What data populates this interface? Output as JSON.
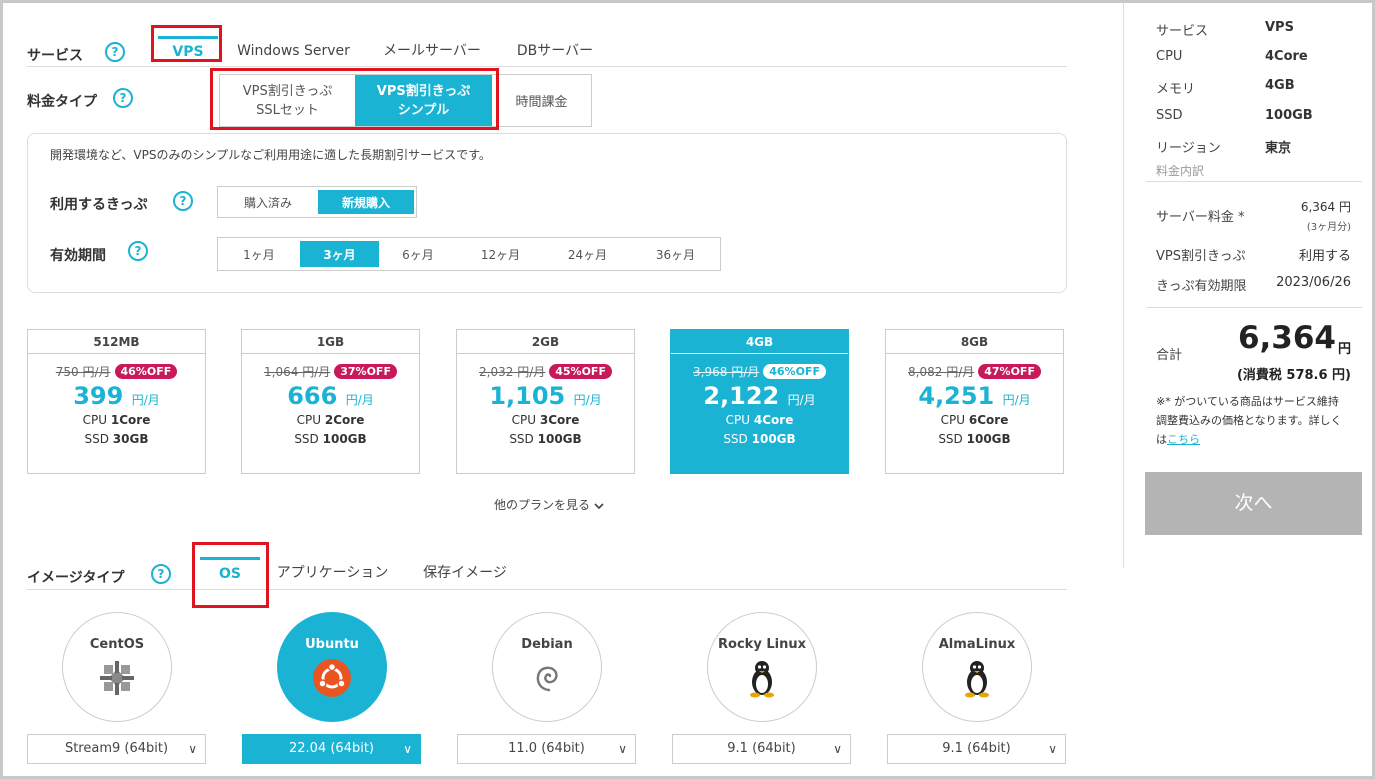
{
  "service": {
    "label": "サービス",
    "tabs": [
      "VPS",
      "Windows Server",
      "メールサーバー",
      "DBサーバー"
    ]
  },
  "plan_type": {
    "label": "料金タイプ",
    "options": [
      {
        "line1": "VPS割引きっぷ",
        "line2": "SSLセット"
      },
      {
        "line1": "VPS割引きっぷ",
        "line2": "シンプル"
      },
      {
        "line1": "時間課金",
        "line2": ""
      }
    ]
  },
  "description": "開発環境など、VPSのみのシンプルなご利用用途に適した長期割引サービスです。",
  "ticket": {
    "label": "利用するきっぷ",
    "options": [
      "購入済み",
      "新規購入"
    ]
  },
  "period": {
    "label": "有効期間",
    "options": [
      "1ヶ月",
      "3ヶ月",
      "6ヶ月",
      "12ヶ月",
      "24ヶ月",
      "36ヶ月"
    ]
  },
  "plans": [
    {
      "name": "512MB",
      "old": "750 円/月",
      "off": "46%OFF",
      "price": "399",
      "unit": "円/月",
      "cpu_label": "CPU",
      "cpu": "1Core",
      "ssd_label": "SSD",
      "ssd": "30GB"
    },
    {
      "name": "1GB",
      "old": "1,064 円/月",
      "off": "37%OFF",
      "price": "666",
      "unit": "円/月",
      "cpu_label": "CPU",
      "cpu": "2Core",
      "ssd_label": "SSD",
      "ssd": "100GB"
    },
    {
      "name": "2GB",
      "old": "2,032 円/月",
      "off": "45%OFF",
      "price": "1,105",
      "unit": "円/月",
      "cpu_label": "CPU",
      "cpu": "3Core",
      "ssd_label": "SSD",
      "ssd": "100GB"
    },
    {
      "name": "4GB",
      "old": "3,968 円/月",
      "off": "46%OFF",
      "price": "2,122",
      "unit": "円/月",
      "cpu_label": "CPU",
      "cpu": "4Core",
      "ssd_label": "SSD",
      "ssd": "100GB"
    },
    {
      "name": "8GB",
      "old": "8,082 円/月",
      "off": "47%OFF",
      "price": "4,251",
      "unit": "円/月",
      "cpu_label": "CPU",
      "cpu": "6Core",
      "ssd_label": "SSD",
      "ssd": "100GB"
    }
  ],
  "more_plans": "他のプランを見る",
  "image_type": {
    "label": "イメージタイプ",
    "tabs": [
      "OS",
      "アプリケーション",
      "保存イメージ"
    ]
  },
  "os": [
    {
      "name": "CentOS",
      "icon": "centos-icon",
      "version": "Stream9 (64bit)"
    },
    {
      "name": "Ubuntu",
      "icon": "ubuntu-icon",
      "version": "22.04 (64bit)"
    },
    {
      "name": "Debian",
      "icon": "debian-icon",
      "version": "11.0 (64bit)"
    },
    {
      "name": "Rocky Linux",
      "icon": "tux-icon",
      "version": "9.1 (64bit)"
    },
    {
      "name": "AlmaLinux",
      "icon": "tux-icon",
      "version": "9.1 (64bit)"
    }
  ],
  "summary": {
    "rows": [
      {
        "k": "サービス",
        "v": "VPS"
      },
      {
        "k": "CPU",
        "v": "4Core"
      },
      {
        "k": "メモリ",
        "v": "4GB"
      },
      {
        "k": "SSD",
        "v": "100GB"
      },
      {
        "k": "リージョン",
        "v": "東京"
      }
    ],
    "breakdown_label": "料金内訳",
    "server_fee_label": "サーバー料金 *",
    "server_fee": "6,364 円",
    "server_fee_note": "(3ヶ月分)",
    "ticket_label": "VPS割引きっぷ",
    "ticket_value": "利用する",
    "expiry_label": "きっぷ有効期限",
    "expiry_value": "2023/06/26",
    "total_label": "合計",
    "total": "6,364",
    "total_unit": "円",
    "tax": "(消費税 578.6 円)",
    "note": "※* がついている商品はサービス維持調整費込みの価格となります。詳しくは",
    "note_link": "こちら",
    "next_button": "次へ"
  },
  "colors": {
    "accent": "#1ab3d4",
    "badge": "#c8195a",
    "highlight": "#e0141e",
    "disabled": "#b4b4b4"
  }
}
